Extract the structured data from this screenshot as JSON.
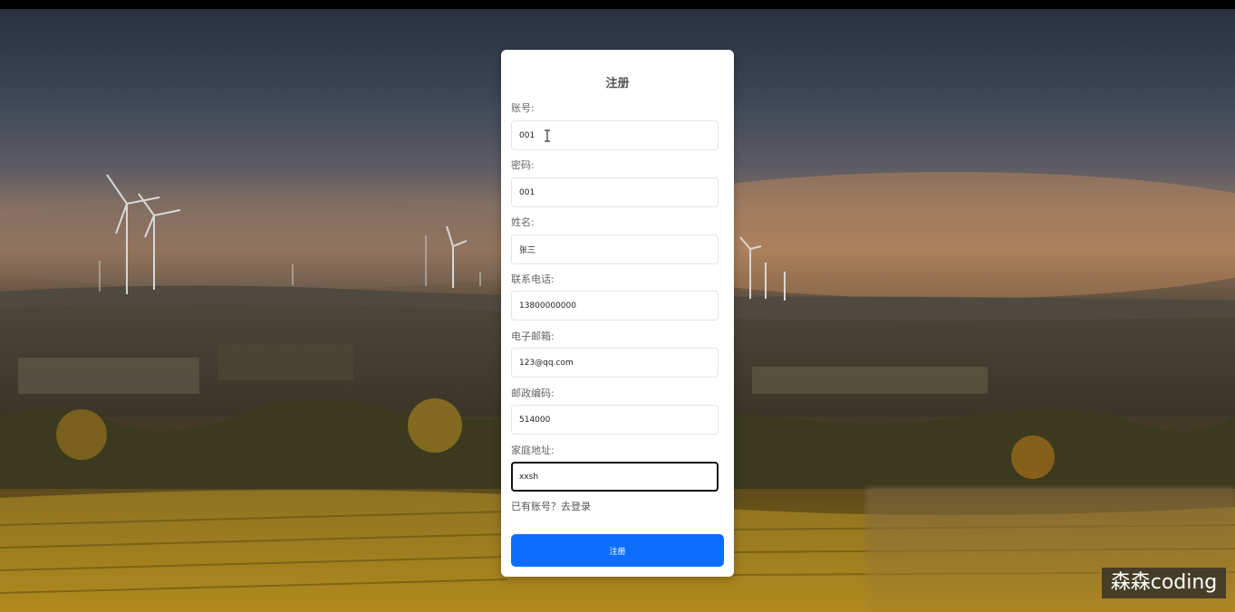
{
  "form": {
    "title": "注册",
    "fields": [
      {
        "label": "账号:",
        "value": "001"
      },
      {
        "label": "密码:",
        "value": "001"
      },
      {
        "label": "姓名:",
        "value": "张三"
      },
      {
        "label": "联系电话:",
        "value": "13800000000"
      },
      {
        "label": "电子邮箱:",
        "value": "123@qq.com"
      },
      {
        "label": "邮政编码:",
        "value": "514000"
      },
      {
        "label": "家庭地址:",
        "value": "xxsh"
      }
    ],
    "login_link": "已有账号？去登录",
    "submit_label": "注册"
  },
  "watermark": "森森coding",
  "colors": {
    "accent": "#0d6efd",
    "card_bg": "#ffffff",
    "top_bar": "#000000"
  }
}
